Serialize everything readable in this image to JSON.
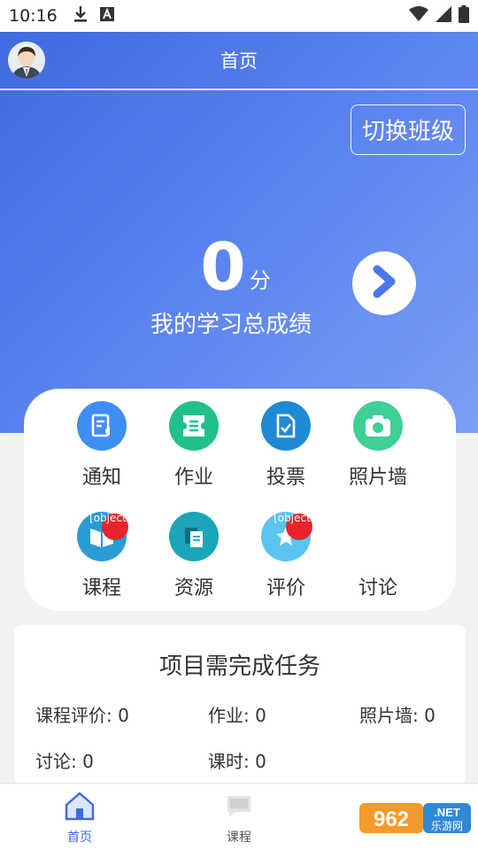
{
  "status_bar": {
    "time": "10:16",
    "left_icons": [
      "download-icon",
      "font-a-icon"
    ],
    "right_icons": [
      "wifi-icon",
      "signal-icon",
      "battery-icon"
    ]
  },
  "header": {
    "title": "首页"
  },
  "switch_class_label": "切换班级",
  "score": {
    "value": "0",
    "unit": "分",
    "label": "我的学习总成绩"
  },
  "menu": {
    "items": [
      {
        "label": "通知",
        "icon": "notice-icon",
        "color": "#3f8ef3"
      },
      {
        "label": "作业",
        "icon": "homework-icon",
        "color": "#1fc189"
      },
      {
        "label": "投票",
        "icon": "vote-icon",
        "color": "#1e8ad6"
      },
      {
        "label": "照片墙",
        "icon": "camera-icon",
        "color": "#3fcf97"
      },
      {
        "label": "课程",
        "icon": "course-book-icon",
        "color": "#2a9bd4",
        "badge": "[object Object]"
      },
      {
        "label": "资源",
        "icon": "resource-icon",
        "color": "#1aa6b8"
      },
      {
        "label": "评价",
        "icon": "evaluation-icon",
        "color": "#5ac3f0",
        "badge": "[object Object]"
      },
      {
        "label": "讨论",
        "icon": "",
        "color": ""
      }
    ]
  },
  "tasks": {
    "title": "项目需完成任务",
    "stats": [
      {
        "label": "课程评价: 0"
      },
      {
        "label": "作业: 0"
      },
      {
        "label": "照片墙: 0"
      },
      {
        "label": "讨论: 0"
      },
      {
        "label": "课时: 0"
      }
    ]
  },
  "tab_bar": {
    "tabs": [
      {
        "label": "首页",
        "icon": "home-icon",
        "active": true
      },
      {
        "label": "课程",
        "icon": "chat-icon",
        "active": false
      }
    ]
  },
  "watermark": {
    "text": "962.NET 乐游网"
  },
  "colors": {
    "accent": "#3f6ae0",
    "accent_light": "#7b9ff6",
    "badge": "#e8232b"
  }
}
